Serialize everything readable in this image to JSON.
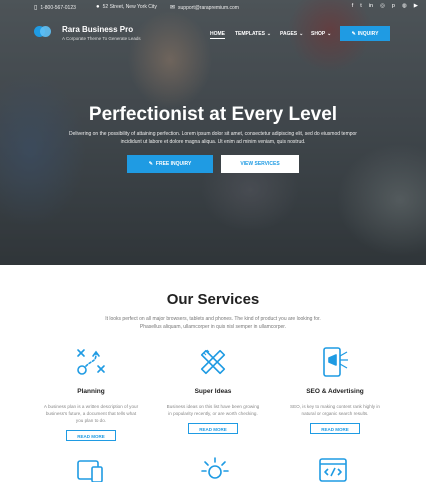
{
  "topbar": {
    "phone": "1-800-567-0123",
    "address": "52 Street, New York City",
    "email": "support@rarapremium.com",
    "social_icons": [
      "facebook-icon",
      "twitter-icon",
      "linkedin-icon",
      "instagram-icon",
      "pinterest-icon",
      "dribbble-icon",
      "youtube-icon"
    ]
  },
  "brand": {
    "name": "Rara Business Pro",
    "tagline": "A Corporate Theme To Generate Leads"
  },
  "nav": {
    "items": [
      "HOME",
      "TEMPLATES",
      "PAGES",
      "SHOP"
    ],
    "inquiry_label": "INQUIRY"
  },
  "hero": {
    "title": "Perfectionist at Every Level",
    "description": "Delivering on the possibility of attaining perfection. Lorem ipsum dolor sit amet, consectetur adipiscing elit, sed do eiusmod tempor incididunt ut labore et dolore magna aliqua. Ut enim ad minim veniam, quis nostrud.",
    "primary_button": "FREE INQUIRY",
    "secondary_button": "VIEW SERVICES"
  },
  "services": {
    "title": "Our Services",
    "subtitle": "It looks perfect on all major browsers, tablets and phones. The kind of product you are looking for. Phasellus aliquam, ullamcorper in quis nisl semper in ullamcorper.",
    "items": [
      {
        "title": "Planning",
        "icon": "planning-icon",
        "description": "A business plan is a written description of your business's future, a document that tells what you plan to do.",
        "button": "READ MORE"
      },
      {
        "title": "Super Ideas",
        "icon": "pencil-ruler-icon",
        "description": "Business ideas on this list have been growing in popularity recently, or are worth checking.",
        "button": "READ MORE"
      },
      {
        "title": "SEO & Advertising",
        "icon": "megaphone-phone-icon",
        "description": "SEO, is key to making content rank highly in natural or organic search results.",
        "button": "READ MORE"
      }
    ],
    "next_row_icons": [
      "devices-icon",
      "lightbulb-icon",
      "code-window-icon"
    ]
  },
  "colors": {
    "accent": "#1f9be3"
  }
}
